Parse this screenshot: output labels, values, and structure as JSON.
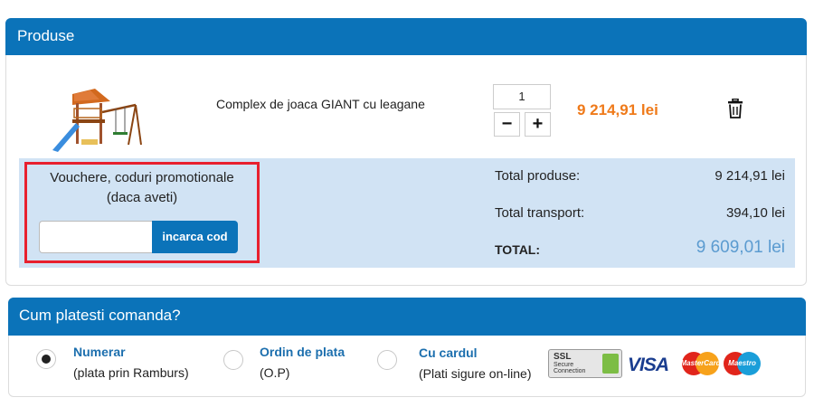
{
  "products": {
    "header_title": "Produse",
    "item": {
      "name": "Complex de joaca GIANT cu leagane",
      "quantity": "1",
      "minus_label": "−",
      "plus_label": "+",
      "price": "9 214,91 lei",
      "image_icon": "playground-set-image",
      "remove_icon": "trash-icon"
    },
    "voucher": {
      "title_line1": "Vouchere, coduri promotionale",
      "title_line2": "(daca aveti)",
      "input_value": "",
      "button_label": "incarca cod"
    },
    "totals": {
      "products_label": "Total produse:",
      "products_value": "9 214,91 lei",
      "transport_label": "Total transport:",
      "transport_value": "394,10 lei",
      "total_label": "TOTAL:",
      "total_value": "9 609,01 lei"
    }
  },
  "payment": {
    "header_title": "Cum platesti comanda?",
    "options": [
      {
        "title": "Numerar",
        "subtitle": "(plata prin Ramburs)",
        "selected": true
      },
      {
        "title": "Ordin de plata",
        "subtitle": "(O.P)",
        "selected": false
      },
      {
        "title": "Cu cardul",
        "subtitle": "(Plati sigure on-line)",
        "selected": false
      }
    ],
    "badges": {
      "ssl_line1": "SSL",
      "ssl_line2": "Secure",
      "ssl_line3": "Connection",
      "visa": "VISA",
      "mastercard": "MasterCard",
      "maestro": "Maestro"
    }
  },
  "colors": {
    "header_blue": "#0b73b9",
    "price_orange": "#ef7a1a",
    "summary_bg": "#d1e3f4",
    "highlight_red": "#e8202e",
    "total_blue": "#5b9bd0"
  }
}
